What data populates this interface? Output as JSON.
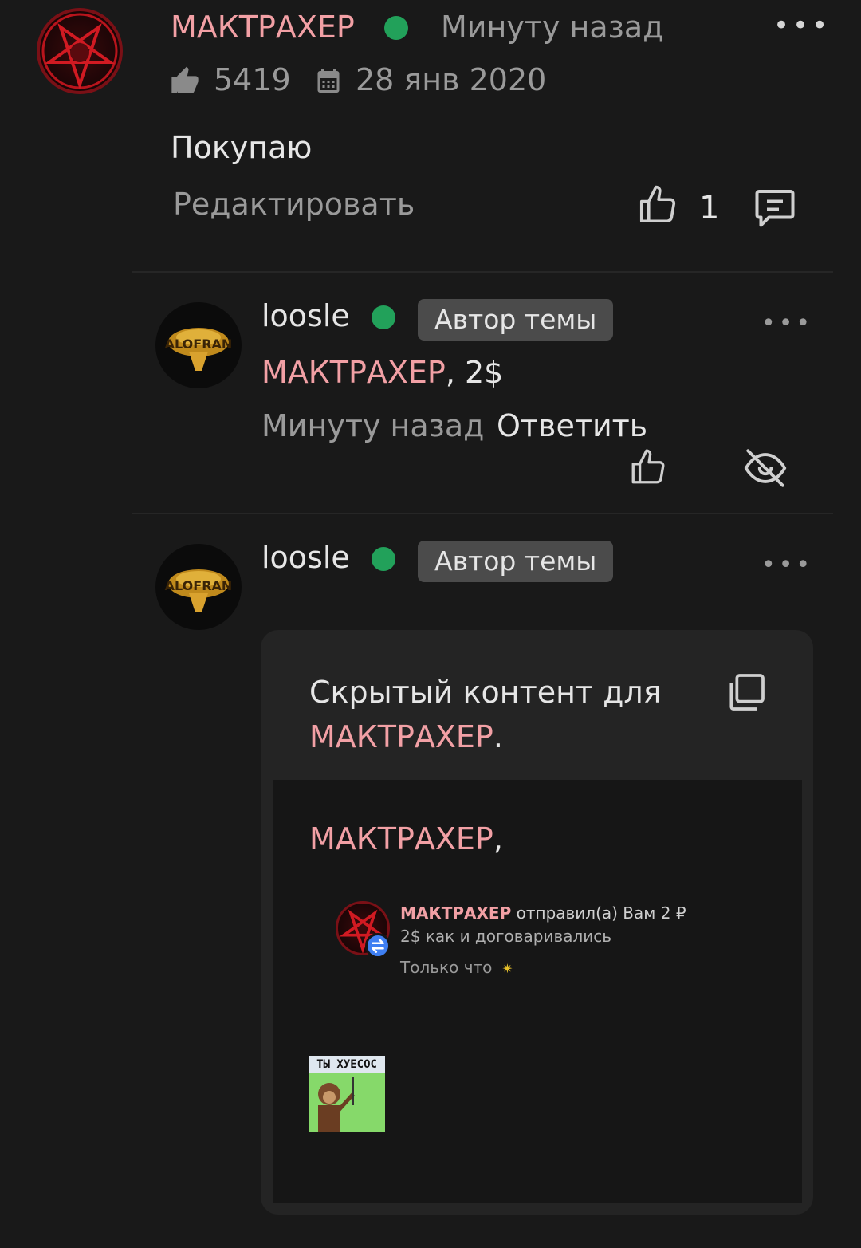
{
  "post": {
    "author": "МАКТРАХЕР",
    "time": "Минуту назад",
    "likes_count": "5419",
    "join_date": "28 янв 2020",
    "text": "Покупаю",
    "edit_label": "Редактировать",
    "reaction_count": "1"
  },
  "replies": [
    {
      "author": "loosle",
      "badge": "Автор темы",
      "mention": "МАКТРАХЕР",
      "text": ", 2$",
      "time": "Минуту назад",
      "reply_label": "Ответить"
    },
    {
      "author": "loosle",
      "badge": "Автор темы",
      "hidden": {
        "title_prefix": "Скрытый контент для",
        "title_user": "МАКТРАХЕР",
        "title_suffix": ".",
        "greeting_user": "МАКТРАХЕР",
        "greeting_suffix": ",",
        "notification": {
          "sender": "МАКТРАХЕР",
          "action": " отправил(а) Вам 2 ₽",
          "message": "2$ как и договаривались",
          "time": "Только что"
        },
        "sticker_text": "ТЫ ХУЕСОС"
      }
    }
  ],
  "colors": {
    "background": "#191919",
    "accent_pink": "#f2a0a5",
    "online_green": "#22a15a",
    "badge_bg": "#4b4b4b",
    "hidden_bg": "#242424"
  },
  "icons": {
    "like": "thumbs-up-icon",
    "calendar": "calendar-icon",
    "comment": "comment-icon",
    "hide": "eye-off-icon",
    "copy": "copy-icon",
    "more": "more-horizontal-icon"
  }
}
